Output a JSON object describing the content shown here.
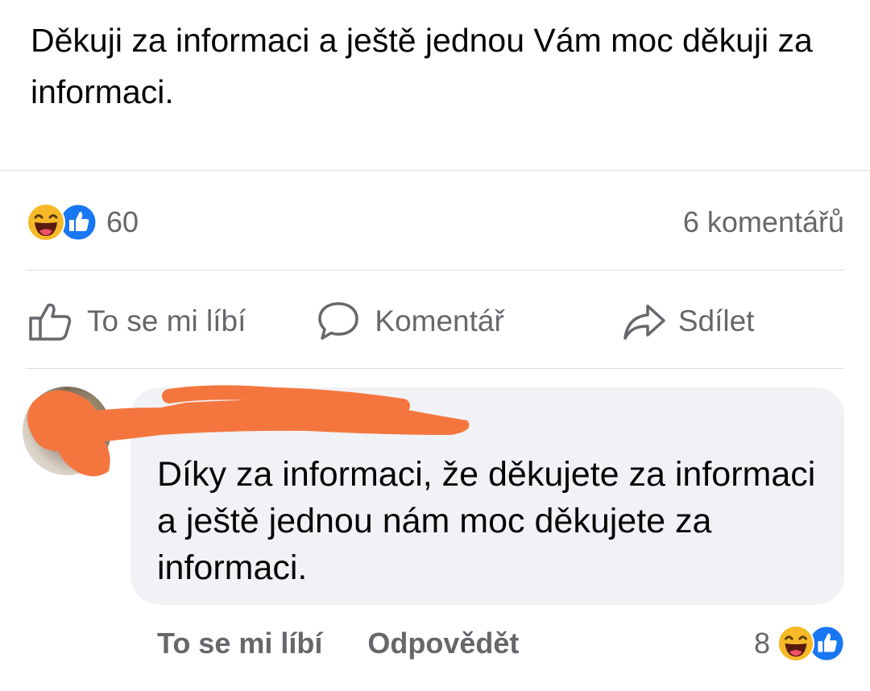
{
  "post": {
    "text": "Děkuji za informaci a ještě jednou Vám moc děkuji za informaci."
  },
  "stats": {
    "reaction_icons": [
      "laughing-emoji-icon",
      "thumbs-up-icon"
    ],
    "reaction_count": "60",
    "comment_count": "6 komentářů"
  },
  "actions": {
    "like_label": "To se mi líbí",
    "comment_label": "Komentář",
    "share_label": "Sdílet"
  },
  "comment": {
    "author_redacted": true,
    "text": "Díky za informaci, že děkujete za informaci a ještě jednou nám moc děkujete za informaci.",
    "like_label": "To se mi líbí",
    "reply_label": "Odpovědět",
    "reaction_count": "8",
    "reaction_icons": [
      "laughing-emoji-icon",
      "thumbs-up-icon"
    ]
  },
  "colors": {
    "text_primary": "#050505",
    "text_secondary": "#65676b",
    "like_blue": "#1877f2",
    "haha_yellow": "#f7b928",
    "redaction_orange": "#f4763e",
    "bubble_bg": "#f0f2f5",
    "divider": "#dadde1"
  }
}
